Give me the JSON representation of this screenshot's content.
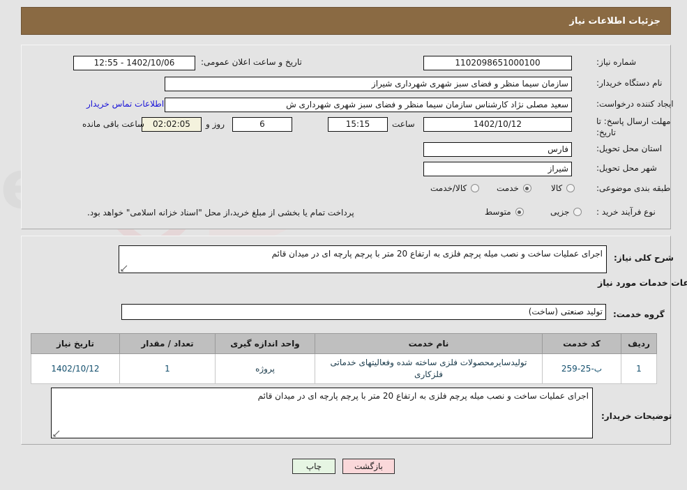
{
  "header": {
    "title": "جزئیات اطلاعات نیاز",
    "bar_color": "#8a6a43"
  },
  "top_form": {
    "need_number": {
      "label": "شماره نیاز:",
      "value": "1102098651000100"
    },
    "announce": {
      "label": "تاریخ و ساعت اعلان عمومی:",
      "value": "1402/10/06 - 12:55"
    },
    "buyer_org": {
      "label": "نام دستگاه خریدار:",
      "value": "سازمان سیما منظر و فضای سبز شهری شهرداری شیراز"
    },
    "creator": {
      "label": "ایجاد کننده درخواست:",
      "value": "سعید مصلی نژاد کارشناس سازمان سیما منظر و فضای سبز شهری شهرداری ش",
      "link": "اطلاعات تماس خریدار"
    },
    "deadline": {
      "label": "مهلت ارسال پاسخ: تا تاریخ:",
      "date": "1402/10/12",
      "time_label": "ساعت",
      "time": "15:15",
      "days": "6",
      "days_label": "روز و",
      "countdown": "02:02:05",
      "remaining_label": "ساعت باقی مانده"
    },
    "province": {
      "label": "استان محل تحویل:",
      "value": "فارس"
    },
    "city": {
      "label": "شهر محل تحویل:",
      "value": "شیراز"
    },
    "category": {
      "label": "طبقه بندی موضوعی:",
      "options": [
        {
          "label": "کالا",
          "selected": false
        },
        {
          "label": "خدمت",
          "selected": true
        },
        {
          "label": "کالا/خدمت",
          "selected": false
        }
      ]
    },
    "process_type": {
      "label": "نوع فرآیند خرید :",
      "options": [
        {
          "label": "جزیی",
          "selected": false
        },
        {
          "label": "متوسط",
          "selected": true
        }
      ],
      "note": "پرداخت تمام یا بخشی از مبلغ خرید،از محل \"اسناد خزانه اسلامی\" خواهد بود."
    }
  },
  "mid_form": {
    "general_desc": {
      "label": "شرح کلی نیاز:",
      "value": "اجرای عملیات ساخت و نصب میله پرچم فلزی به ارتفاع 20 متر با پرچم پارچه ای در میدان قائم"
    },
    "section_title": "اطلاعات خدمات مورد نیاز",
    "service_group": {
      "label": "گروه خدمت:",
      "value": "تولید صنعتی (ساخت)"
    },
    "buyer_notes": {
      "label": "توضیحات خریدار:",
      "value": "اجرای عملیات ساخت و نصب میله پرچم فلزی به ارتفاع 20 متر با پرچم پارچه ای در میدان قائم"
    }
  },
  "table": {
    "columns": [
      "ردیف",
      "کد خدمت",
      "نام خدمت",
      "واحد اندازه گیری",
      "تعداد / مقدار",
      "تاریخ نیاز"
    ],
    "rows": [
      {
        "radif": "1",
        "code": "ب-25-259",
        "name": "تولیدسایرمحصولات فلزی ساخته شده وفعالیتهای خدماتی فلزکاری",
        "unit": "پروژه",
        "qty": "1",
        "date": "1402/10/12"
      }
    ]
  },
  "buttons": {
    "print": "چاپ",
    "back": "بازگشت"
  },
  "watermark": {
    "text": "AriaTender.net"
  }
}
